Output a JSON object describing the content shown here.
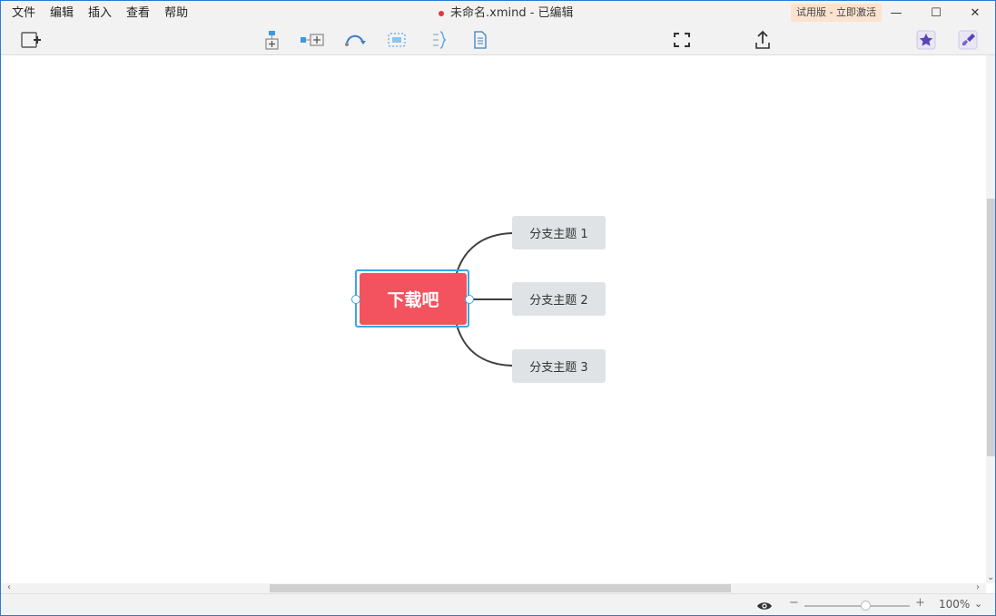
{
  "menu": [
    "文件",
    "编辑",
    "插入",
    "查看",
    "帮助"
  ],
  "window": {
    "title": "未命名.xmind - 已编辑",
    "trial_label": "试用版 - 立即激活",
    "minimize": "—",
    "maximize": "☐",
    "close": "✕"
  },
  "toolbar": {
    "icons": [
      "new-sheet-icon",
      "subtopic-icon",
      "topic-icon",
      "relationship-icon",
      "boundary-icon",
      "summary-icon",
      "notes-icon",
      "fullscreen-icon",
      "share-icon",
      "marker-icon",
      "format-icon"
    ]
  },
  "map": {
    "central_topic": "下载吧",
    "central_color": "#f3535e",
    "selection_color": "#38a6ea",
    "branches": [
      "分支主题 1",
      "分支主题 2",
      "分支主题 3"
    ]
  },
  "status": {
    "zoom_label": "100%",
    "zoom_level": 0.5
  }
}
